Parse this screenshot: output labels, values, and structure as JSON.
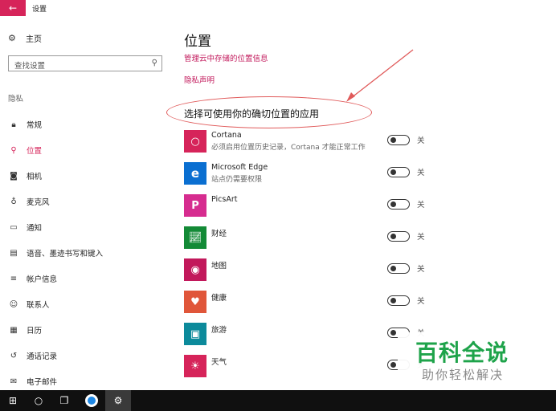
{
  "window": {
    "title": "设置"
  },
  "sidebar": {
    "home_label": "主页",
    "search_placeholder": "查找设置",
    "section_label": "隐私",
    "items": [
      {
        "label": "常规",
        "icon": "lock-icon"
      },
      {
        "label": "位置",
        "icon": "location-icon",
        "active": true
      },
      {
        "label": "相机",
        "icon": "camera-icon"
      },
      {
        "label": "麦克风",
        "icon": "microphone-icon"
      },
      {
        "label": "通知",
        "icon": "notification-icon"
      },
      {
        "label": "语音、墨迹书写和键入",
        "icon": "clipboard-icon"
      },
      {
        "label": "帐户信息",
        "icon": "account-info-icon"
      },
      {
        "label": "联系人",
        "icon": "contacts-icon"
      },
      {
        "label": "日历",
        "icon": "calendar-icon"
      },
      {
        "label": "通话记录",
        "icon": "call-history-icon"
      },
      {
        "label": "电子邮件",
        "icon": "email-icon"
      }
    ]
  },
  "main": {
    "title": "位置",
    "link_manage": "管理云中存储的位置信息",
    "link_privacy": "隐私声明",
    "subtitle": "选择可使用你的确切位置的应用",
    "apps": [
      {
        "name": "Cortana",
        "desc": "必须启用位置历史记录，Cortana 才能正常工作",
        "toggle": "关",
        "color": "#d6245a",
        "icon": "cortana-icon"
      },
      {
        "name": "Microsoft Edge",
        "desc": "站点仍需要权限",
        "toggle": "关",
        "color": "#0a6fd1",
        "icon": "edge-icon"
      },
      {
        "name": "PicsArt",
        "desc": "",
        "toggle": "关",
        "color": "#d62c8f",
        "icon": "picsart-icon"
      },
      {
        "name": "财经",
        "desc": "",
        "toggle": "关",
        "color": "#138a36",
        "icon": "finance-icon"
      },
      {
        "name": "地图",
        "desc": "",
        "toggle": "关",
        "color": "#c2185b",
        "icon": "maps-icon"
      },
      {
        "name": "健康",
        "desc": "",
        "toggle": "关",
        "color": "#e0563a",
        "icon": "health-icon"
      },
      {
        "name": "旅游",
        "desc": "",
        "toggle": "关",
        "color": "#0c8a9b",
        "icon": "travel-icon"
      },
      {
        "name": "天气",
        "desc": "",
        "toggle": "关",
        "color": "#d6245a",
        "icon": "weather-icon"
      }
    ]
  },
  "watermark": {
    "main": "百科全说",
    "sub": "助你轻松解决"
  },
  "taskbar": {
    "items": [
      {
        "icon": "windows-start-icon"
      },
      {
        "icon": "cortana-search-icon"
      },
      {
        "icon": "task-view-icon"
      },
      {
        "icon": "browser-icon"
      },
      {
        "icon": "settings-gear-icon",
        "active": true
      }
    ]
  },
  "colors": {
    "accent": "#d6245a",
    "link": "#c2185b",
    "annotation": "#e05a5a",
    "watermark_green": "#1ea34a"
  }
}
